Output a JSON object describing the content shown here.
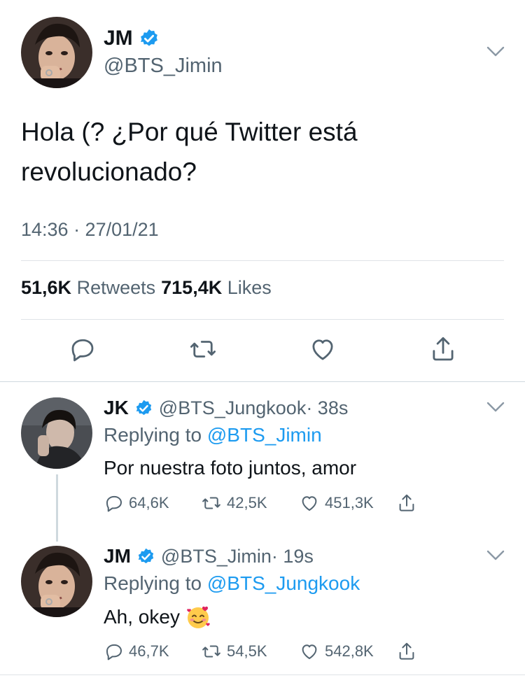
{
  "main_tweet": {
    "name": "JM",
    "handle": "@BTS_Jimin",
    "text": "Hola (? ¿Por qué Twitter está revolucionado?",
    "timestamp": "14:36 · 27/01/21",
    "retweets_count": "51,6K",
    "retweets_label": "Retweets",
    "likes_count": "715,4K",
    "likes_label": "Likes"
  },
  "replies": [
    {
      "name": "JK",
      "handle": "@BTS_Jungkook",
      "time": "· 38s",
      "replying_prefix": "Replying to",
      "replying_to": "@BTS_Jimin",
      "text": "Por nuestra foto juntos, amor",
      "replies_count": "64,6K",
      "retweets_count": "42,5K",
      "likes_count": "451,3K"
    },
    {
      "name": "JM",
      "handle": "@BTS_Jimin",
      "time": "· 19s",
      "replying_prefix": "Replying to",
      "replying_to": "@BTS_Jungkook",
      "text": "Ah, okey",
      "emoji": "smiling-face-with-hearts-icon",
      "replies_count": "46,7K",
      "retweets_count": "54,5K",
      "likes_count": "542,8K"
    }
  ],
  "colors": {
    "accent": "#1d9bf0",
    "secondary_text": "#536471",
    "primary_text": "#0f1419"
  }
}
